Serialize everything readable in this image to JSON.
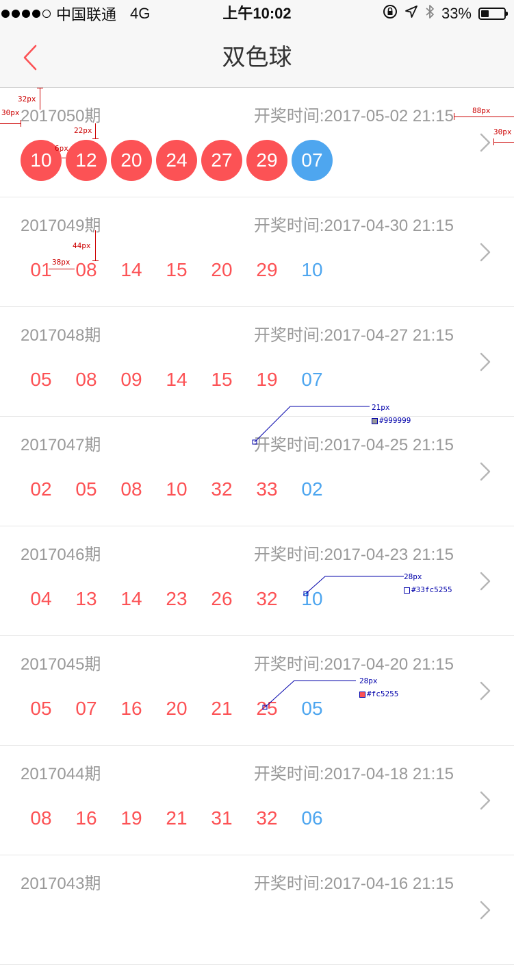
{
  "status_bar": {
    "carrier": "中国联通",
    "network": "4G",
    "time": "上午10:02",
    "battery_percent": "33%",
    "battery_level": 0.33,
    "signal_bars_filled": 4,
    "icons": [
      "rotation-lock-icon",
      "location-arrow-icon",
      "bluetooth-icon",
      "battery-icon"
    ]
  },
  "nav": {
    "title": "双色球",
    "back_icon": "chevron-left-icon"
  },
  "colors": {
    "red": "#fc5255",
    "blue": "#4ea6ef",
    "gray_text": "#999999"
  },
  "draws": [
    {
      "issue": "2017050期",
      "time": "开奖时间:2017-05-02 21:15",
      "red": [
        "10",
        "12",
        "20",
        "24",
        "27",
        "29"
      ],
      "blue": "07"
    },
    {
      "issue": "2017049期",
      "time": "开奖时间:2017-04-30 21:15",
      "red": [
        "01",
        "08",
        "14",
        "15",
        "20",
        "29"
      ],
      "blue": "10"
    },
    {
      "issue": "2017048期",
      "time": "开奖时间:2017-04-27 21:15",
      "red": [
        "05",
        "08",
        "09",
        "14",
        "15",
        "19"
      ],
      "blue": "07"
    },
    {
      "issue": "2017047期",
      "time": "开奖时间:2017-04-25 21:15",
      "red": [
        "02",
        "05",
        "08",
        "10",
        "32",
        "33"
      ],
      "blue": "02"
    },
    {
      "issue": "2017046期",
      "time": "开奖时间:2017-04-23 21:15",
      "red": [
        "04",
        "13",
        "14",
        "23",
        "26",
        "32"
      ],
      "blue": "10"
    },
    {
      "issue": "2017045期",
      "time": "开奖时间:2017-04-20 21:15",
      "red": [
        "05",
        "07",
        "16",
        "20",
        "21",
        "25"
      ],
      "blue": "05"
    },
    {
      "issue": "2017044期",
      "time": "开奖时间:2017-04-18 21:15",
      "red": [
        "08",
        "16",
        "19",
        "21",
        "31",
        "32"
      ],
      "blue": "06"
    },
    {
      "issue": "2017043期",
      "time": "开奖时间:2017-04-16 21:15",
      "red": [],
      "blue": ""
    }
  ],
  "annotations": {
    "top_margin": "32px",
    "left_margin": "30px",
    "right_gap": "88px",
    "right_margin": "30px",
    "row_gap": "22px",
    "ball_gap": "6px",
    "number_row_offset": "44px",
    "number_spacing": "38px",
    "time_font_size": "21px",
    "time_color": "#999999",
    "blue_font_size": "28px",
    "blue_color": "#33fc5255",
    "red_font_size": "28px",
    "red_color": "#fc5255"
  }
}
